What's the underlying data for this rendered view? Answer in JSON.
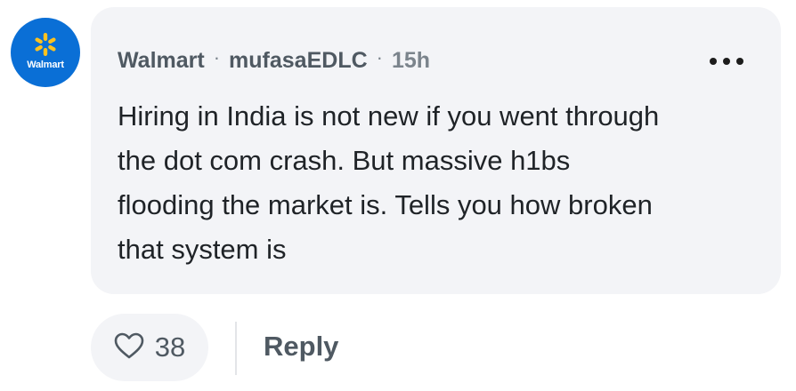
{
  "comment": {
    "avatar": {
      "label": "Walmart",
      "brand_color": "#0a6fd6",
      "spark_color": "#ffc220",
      "icon": "walmart-spark-icon"
    },
    "company": "Walmart",
    "username": "mufasaEDLC",
    "separator": "·",
    "time": "15h",
    "more_icon": "more-horizontal-icon",
    "text": "Hiring in India is not new if you went through\nthe dot com crash.  But massive h1bs\nflooding the market is.  Tells you how broken\nthat system is"
  },
  "actions": {
    "like_icon": "heart-outline-icon",
    "like_count": "38",
    "reply_label": "Reply"
  }
}
